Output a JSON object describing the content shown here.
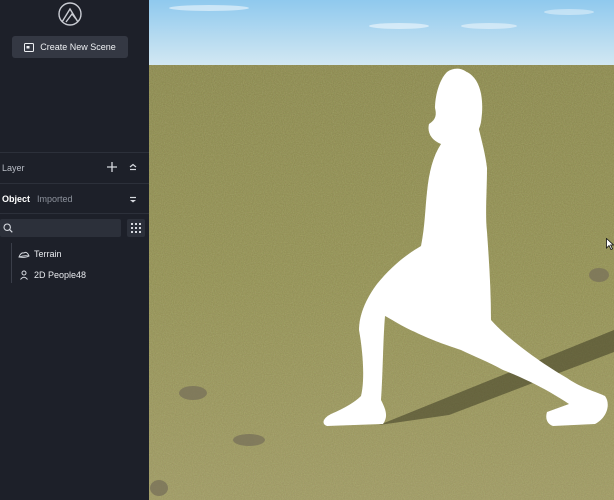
{
  "sidebar": {
    "create_button_label": "Create New Scene",
    "layer_label": "Layer",
    "tabs": {
      "object": "Object",
      "imported": "Imported"
    },
    "search_placeholder": "",
    "tree_items": [
      {
        "label": "Terrain",
        "icon": "terrain-icon"
      },
      {
        "label": "2D People48",
        "icon": "person-icon"
      }
    ]
  },
  "icons": {
    "logo": "mountain-logo",
    "create": "scene-screen-icon",
    "layer_add": "plus-icon",
    "layer_collapse": "chevron-up-icon",
    "tabs_menu": "caret-down-icon",
    "search": "search-icon",
    "grid": "grid-view-icon"
  },
  "colors": {
    "sidebar_bg": "#1d2029",
    "button_bg": "#343843",
    "sky": "#a9d6f2",
    "ground": "#8f8c52",
    "figure": "#ffffff"
  }
}
